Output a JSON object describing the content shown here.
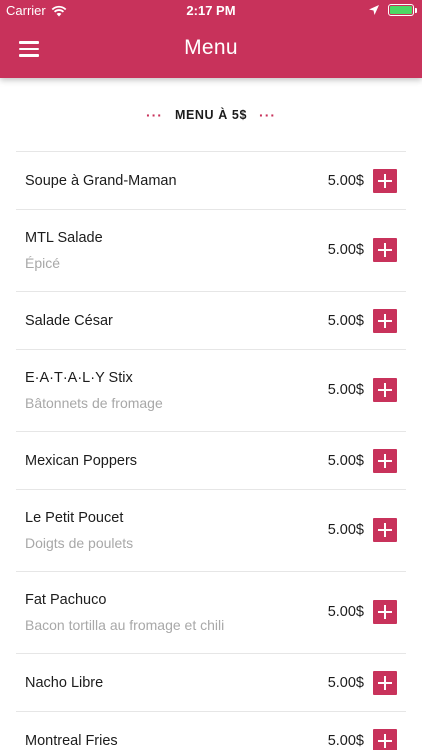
{
  "status_bar": {
    "carrier": "Carrier",
    "time": "2:17 PM",
    "battery_percent": 100
  },
  "header": {
    "title": "Menu",
    "menu_icon": "hamburger-icon"
  },
  "section": {
    "title": "MENU À 5$",
    "dots_left": "···",
    "dots_right": "···"
  },
  "colors": {
    "brand": "#c8325b",
    "battery": "#4cd964",
    "description": "#a8a8a8"
  },
  "items": [
    {
      "name": "Soupe à Grand-Maman",
      "description": "",
      "price": "5.00$"
    },
    {
      "name": "MTL Salade",
      "description": "Épicé",
      "price": "5.00$"
    },
    {
      "name": "Salade César",
      "description": "",
      "price": "5.00$"
    },
    {
      "name": "E·A·T·A·L·Y Stix",
      "description": "Bâtonnets de fromage",
      "price": "5.00$"
    },
    {
      "name": "Mexican Poppers",
      "description": "",
      "price": "5.00$"
    },
    {
      "name": "Le Petit Poucet",
      "description": "Doigts de poulets",
      "price": "5.00$"
    },
    {
      "name": "Fat Pachuco",
      "description": "Bacon tortilla au fromage et chili",
      "price": "5.00$"
    },
    {
      "name": "Nacho Libre",
      "description": "",
      "price": "5.00$"
    },
    {
      "name": "Montreal Fries",
      "description": "",
      "price": "5.00$"
    }
  ]
}
